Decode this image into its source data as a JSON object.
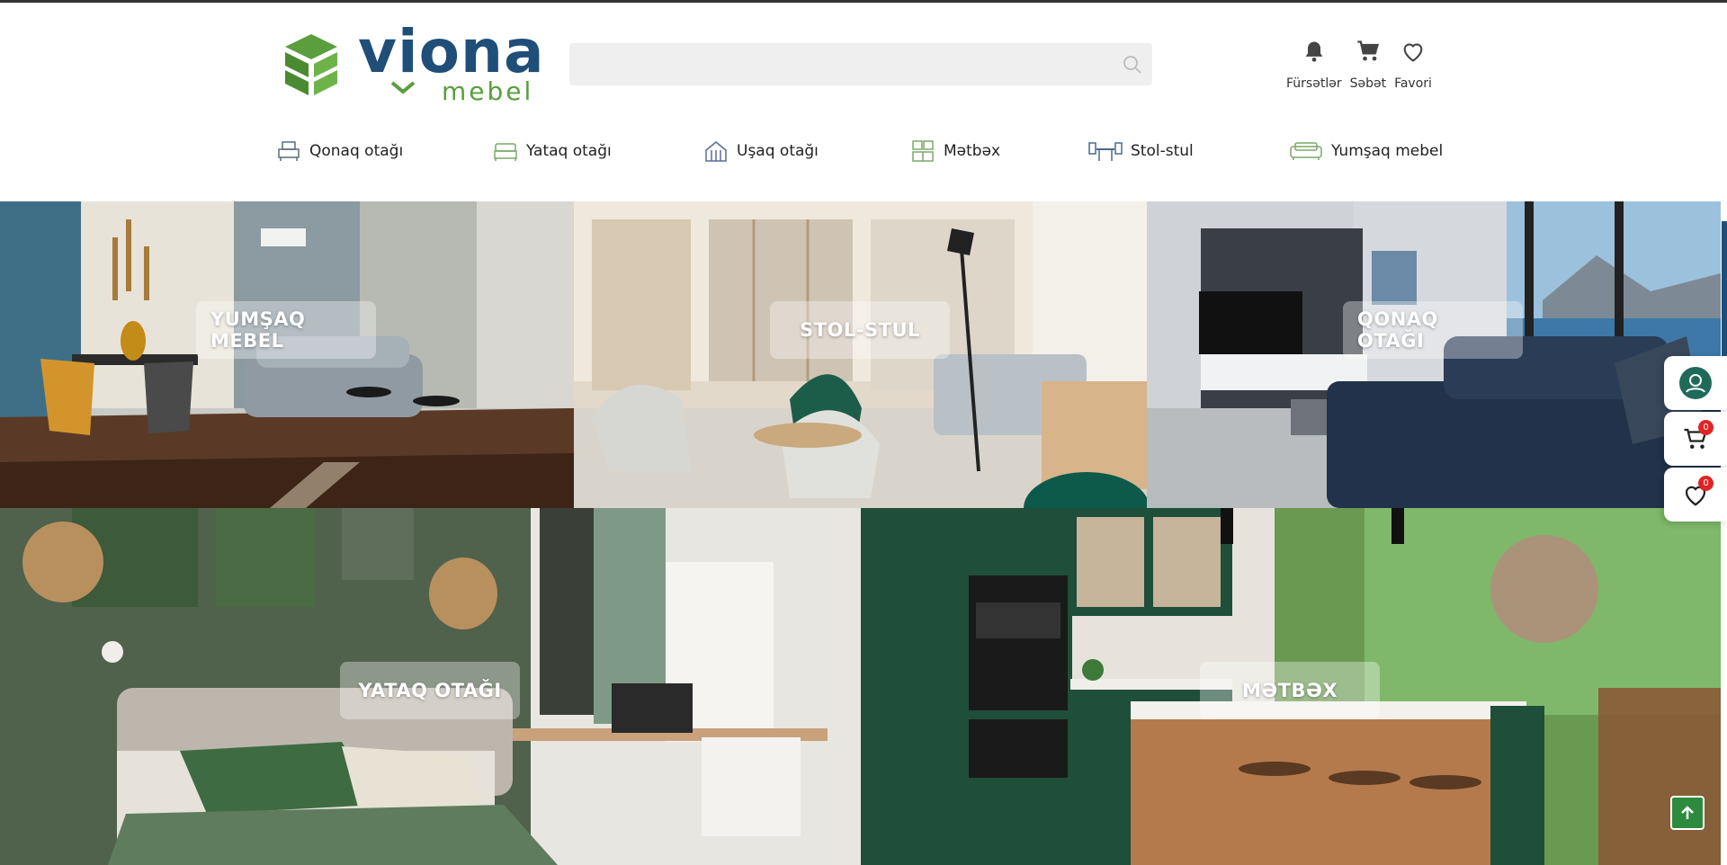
{
  "brand": {
    "name": "viona",
    "tagline": "mebel",
    "color_primary": "#1f4e79",
    "color_accent": "#5a9e3e"
  },
  "search": {
    "placeholder": "",
    "value": ""
  },
  "header_icons": [
    {
      "icon": "bell-icon",
      "label": "Fürsətlər"
    },
    {
      "icon": "cart-icon",
      "label": "Səbət"
    },
    {
      "icon": "heart-icon",
      "label": "Favori"
    }
  ],
  "categories": [
    {
      "icon": "living-room-icon",
      "label": "Qonaq otağı"
    },
    {
      "icon": "bed-icon",
      "label": "Yataq otağı"
    },
    {
      "icon": "kids-room-icon",
      "label": "Uşaq otağı"
    },
    {
      "icon": "kitchen-icon",
      "label": "Mətbəx"
    },
    {
      "icon": "table-chair-icon",
      "label": "Stol-stul"
    },
    {
      "icon": "sofa-icon",
      "label": "Yumşaq mebel"
    }
  ],
  "tiles": [
    {
      "label": "YUMŞAQ MEBEL"
    },
    {
      "label": "STOL-STUL"
    },
    {
      "label": "QONAQ OTAĞI"
    },
    {
      "label": "YATAQ OTAĞI"
    },
    {
      "label": "MƏTBƏX"
    }
  ],
  "side_widgets": [
    {
      "icon": "support-chat-icon"
    },
    {
      "icon": "cart-icon",
      "count": "0"
    },
    {
      "icon": "heart-icon",
      "count": "0"
    }
  ],
  "back_to_top": {
    "icon": "arrow-up-icon"
  }
}
